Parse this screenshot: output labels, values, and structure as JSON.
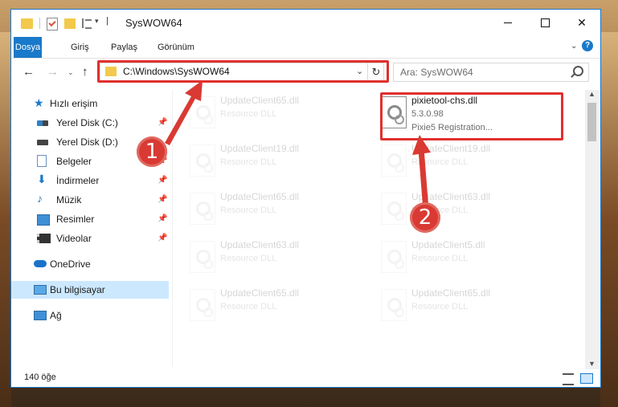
{
  "window": {
    "title": "SysWOW64",
    "controls": {
      "minimize": "",
      "maximize": "",
      "close": "✕"
    }
  },
  "ribbon": {
    "tabs": [
      "Dosya",
      "Giriş",
      "Paylaş",
      "Görünüm"
    ],
    "help": "?",
    "expand": "⌄"
  },
  "nav": {
    "back": "←",
    "forward": "→",
    "recent": "⌄",
    "up": "↑",
    "address": "C:\\Windows\\SysWOW64",
    "address_dropdown": "⌄",
    "refresh": "↻",
    "search_placeholder": "Ara: SysWOW64"
  },
  "sidebar": {
    "items": [
      {
        "label": "Hızlı erişim",
        "icon": "star-icon",
        "pinned": false,
        "level": "top"
      },
      {
        "label": "Yerel Disk (C:)",
        "icon": "drive-icon",
        "pinned": true
      },
      {
        "label": "Yerel Disk (D:)",
        "icon": "drive-icon",
        "pinned": false
      },
      {
        "label": "Belgeler",
        "icon": "document-icon",
        "pinned": true
      },
      {
        "label": "İndirmeler",
        "icon": "download-icon",
        "pinned": true
      },
      {
        "label": "Müzik",
        "icon": "music-icon",
        "pinned": true
      },
      {
        "label": "Resimler",
        "icon": "pictures-icon",
        "pinned": true
      },
      {
        "label": "Videolar",
        "icon": "videos-icon",
        "pinned": true
      },
      {
        "label": "OneDrive",
        "icon": "cloud-icon",
        "pinned": false,
        "level": "top"
      },
      {
        "label": "Bu bilgisayar",
        "icon": "computer-icon",
        "pinned": false,
        "level": "top",
        "selected": true
      },
      {
        "label": "Ağ",
        "icon": "network-icon",
        "pinned": false,
        "level": "top"
      }
    ],
    "pin_glyph": "📌"
  },
  "files": {
    "featured": {
      "name": "pixietool-chs.dll",
      "version": "5.3.0.98",
      "description": "Pixie5 Registration..."
    },
    "faded": [
      {
        "name": "UpdateClient65.dll",
        "desc": "Resource DLL"
      },
      {
        "name": "UpdateClient19.dll",
        "desc": "Resource DLL"
      },
      {
        "name": "UpdateClient19.dll",
        "desc": "Resource DLL"
      },
      {
        "name": "UpdateClient65.dll",
        "desc": "Resource DLL"
      },
      {
        "name": "UpdateClient63.dll",
        "desc": "Resource DLL"
      },
      {
        "name": "UpdateClient63.dll",
        "desc": "Resource DLL"
      },
      {
        "name": "UpdateClient5.dll",
        "desc": "Resource DLL"
      },
      {
        "name": "UpdateClient65.dll",
        "desc": "Resource DLL"
      },
      {
        "name": "UpdateClient65.dll",
        "desc": "Resource DLL"
      }
    ]
  },
  "status": {
    "item_count": "140 öğe"
  },
  "callouts": {
    "step1": "1",
    "step2": "2"
  },
  "colors": {
    "accent": "#1979ca",
    "callout_red": "#d93a33",
    "highlight": "#e0302e",
    "selection": "#cce8ff"
  }
}
